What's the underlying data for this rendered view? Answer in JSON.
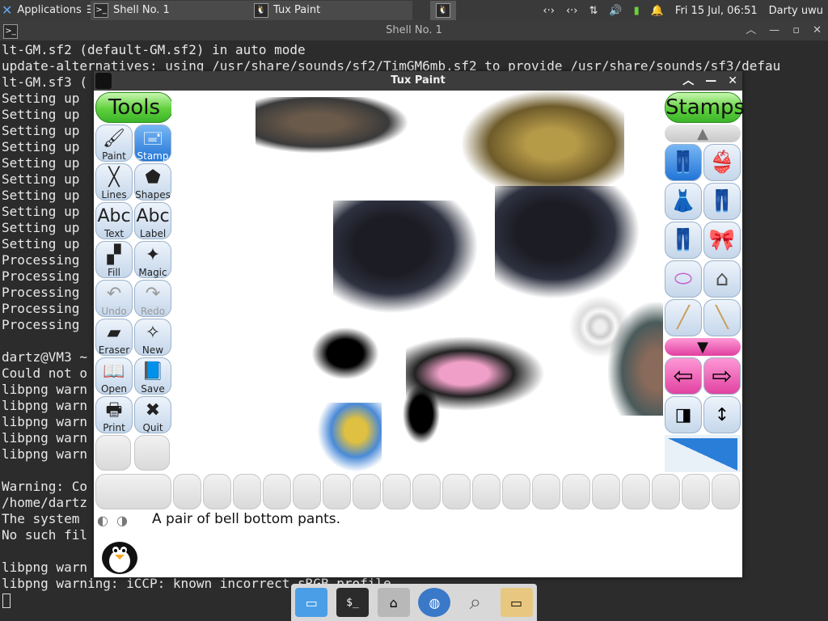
{
  "panel": {
    "apps_label": "Applications",
    "tasks": [
      {
        "label": "Shell No. 1",
        "icon": "terminal-icon"
      },
      {
        "label": "Tux Paint",
        "icon": "tux-icon"
      }
    ],
    "datetime": "Fri 15 Jul, 06:51",
    "user": "Darty uwu"
  },
  "terminal": {
    "title": "Shell No. 1",
    "lines": [
      "lt-GM.sf2 (default-GM.sf2) in auto mode",
      "update-alternatives: using /usr/share/sounds/sf2/TimGM6mb.sf2 to provide /usr/share/sounds/sf3/defau",
      "lt-GM.sf3 (",
      "Setting up",
      "Setting up",
      "Setting up",
      "Setting up",
      "Setting up",
      "Setting up",
      "Setting up",
      "Setting up",
      "Setting up",
      "Setting up",
      "Processing",
      "Processing",
      "Processing",
      "Processing",
      "Processing",
      "",
      "dartz@VM3 ~",
      "Could not o",
      "libpng warn",
      "libpng warn",
      "libpng warn",
      "libpng warn",
      "libpng warn",
      "",
      "Warning: Co",
      "/home/dartz",
      "The system",
      "No such fil",
      "",
      "libpng warn",
      "libpng warning: iCCP: known incorrect sRGB profile"
    ]
  },
  "tuxpaint": {
    "title": "Tux Paint",
    "tools_header": "Tools",
    "stamps_header": "Stamps",
    "tools": [
      {
        "label": "Paint",
        "glyph": "🖌",
        "state": "normal"
      },
      {
        "label": "Stamp",
        "glyph": "🖃",
        "state": "selected"
      },
      {
        "label": "Lines",
        "glyph": "╳",
        "state": "normal"
      },
      {
        "label": "Shapes",
        "glyph": "⬟",
        "state": "normal"
      },
      {
        "label": "Text",
        "glyph": "Abc",
        "state": "normal"
      },
      {
        "label": "Label",
        "glyph": "Abc",
        "state": "normal"
      },
      {
        "label": "Fill",
        "glyph": "▞",
        "state": "normal"
      },
      {
        "label": "Magic",
        "glyph": "✦",
        "state": "normal"
      },
      {
        "label": "Undo",
        "glyph": "↶",
        "state": "disabled"
      },
      {
        "label": "Redo",
        "glyph": "↷",
        "state": "disabled"
      },
      {
        "label": "Eraser",
        "glyph": "▰",
        "state": "normal"
      },
      {
        "label": "New",
        "glyph": "✧",
        "state": "normal"
      },
      {
        "label": "Open",
        "glyph": "📖",
        "state": "normal"
      },
      {
        "label": "Save",
        "glyph": "📘",
        "state": "normal"
      },
      {
        "label": "Print",
        "glyph": "🖶",
        "state": "normal"
      },
      {
        "label": "Quit",
        "glyph": "✖",
        "state": "normal"
      }
    ],
    "stamps": [
      {
        "icon": "bell-bottom-pants-icon",
        "glyph": "👖",
        "color": "#8ec3f0",
        "state": "selected"
      },
      {
        "icon": "bikini-icon",
        "glyph": "👙",
        "color": "#2bb8a8",
        "state": "normal"
      },
      {
        "icon": "dress-icon",
        "glyph": "👗",
        "color": "#222222",
        "state": "normal"
      },
      {
        "icon": "jeans-icon",
        "glyph": "👖",
        "color": "#1a2a6e",
        "state": "normal"
      },
      {
        "icon": "jeans-dark-icon",
        "glyph": "👖",
        "color": "#1a2a6e",
        "state": "normal"
      },
      {
        "icon": "bow-tie-icon",
        "glyph": "🎀",
        "color": "#3cb83c",
        "state": "normal"
      },
      {
        "icon": "button-icon",
        "glyph": "⬭",
        "color": "#c85bd0",
        "state": "normal"
      },
      {
        "icon": "hanger-icon",
        "glyph": "⌂",
        "color": "#555555",
        "state": "normal"
      },
      {
        "icon": "clothespin-icon",
        "glyph": "╱",
        "color": "#c8a060",
        "state": "normal"
      },
      {
        "icon": "safety-pin-icon",
        "glyph": "╲",
        "color": "#c8a060",
        "state": "normal"
      }
    ],
    "info_text": "A pair of bell bottom pants."
  },
  "colors": {
    "green_pill": "#5fd03c",
    "selected_blue": "#1f73d6",
    "magenta_bar": "#e040a0",
    "terminal_bg": "#2c2c2c"
  }
}
